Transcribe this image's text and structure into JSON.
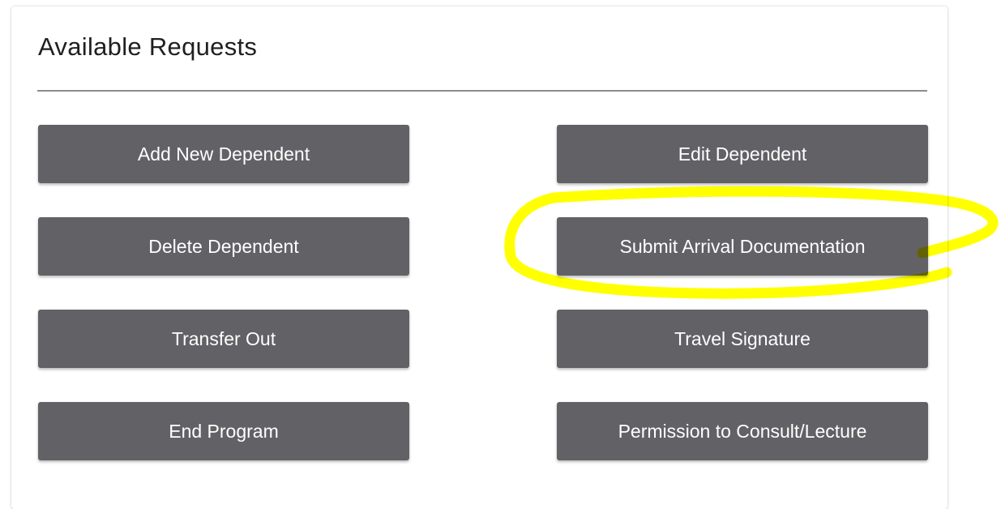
{
  "panel": {
    "title": "Available Requests"
  },
  "requests": {
    "add_new_dependent": "Add New Dependent",
    "edit_dependent": "Edit Dependent",
    "delete_dependent": "Delete Dependent",
    "submit_arrival_documentation": "Submit Arrival Documentation",
    "transfer_out": "Transfer Out",
    "travel_signature": "Travel Signature",
    "end_program": "End Program",
    "permission_to_consult_lecture": "Permission to Consult/Lecture"
  },
  "colors": {
    "button_bg": "#626266",
    "button_text": "#ffffff",
    "highlight": "#ffff00"
  }
}
